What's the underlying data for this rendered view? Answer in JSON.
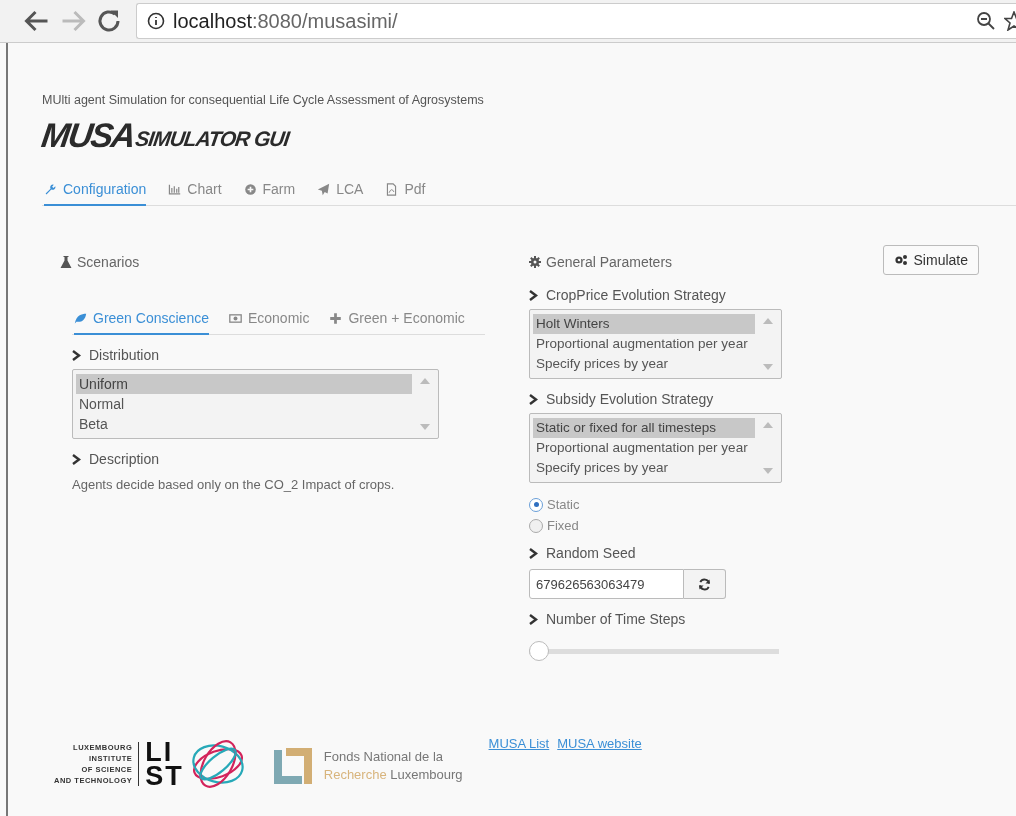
{
  "browser": {
    "host": "localhost",
    "path": ":8080/musasimi/"
  },
  "header": {
    "subtitle": "MUlti agent Simulation for consequential Life Cycle Assessment of Agrosystems",
    "logo_main": "MUSA",
    "logo_sub": "SIMULATOR GUI"
  },
  "tabs": [
    {
      "label": "Configuration",
      "selected": true
    },
    {
      "label": "Chart",
      "selected": false
    },
    {
      "label": "Farm",
      "selected": false
    },
    {
      "label": "LCA",
      "selected": false
    },
    {
      "label": "Pdf",
      "selected": false
    }
  ],
  "scenarios": {
    "title": "Scenarios",
    "tabs": [
      {
        "label": "Green Conscience",
        "selected": true
      },
      {
        "label": "Economic",
        "selected": false
      },
      {
        "label": "Green + Economic",
        "selected": false
      }
    ],
    "distribution": {
      "label": "Distribution",
      "options": [
        {
          "label": "Uniform",
          "selected": true
        },
        {
          "label": "Normal",
          "selected": false
        },
        {
          "label": "Beta",
          "selected": false
        }
      ]
    },
    "description": {
      "label": "Description",
      "text": "Agents decide based only on the CO_2 Impact of crops."
    }
  },
  "general": {
    "title": "General Parameters",
    "simulate": "Simulate",
    "crop_price": {
      "label": "CropPrice Evolution Strategy",
      "options": [
        {
          "label": "Holt Winters",
          "selected": true
        },
        {
          "label": "Proportional augmentation per year",
          "selected": false
        },
        {
          "label": "Specify prices by year",
          "selected": false
        }
      ]
    },
    "subsidy": {
      "label": "Subsidy Evolution Strategy",
      "options": [
        {
          "label": "Static or fixed for all timesteps",
          "selected": true
        },
        {
          "label": "Proportional augmentation per year",
          "selected": false
        },
        {
          "label": "Specify prices by year",
          "selected": false
        }
      ]
    },
    "radios": [
      {
        "label": "Static",
        "selected": true
      },
      {
        "label": "Fixed",
        "selected": false
      }
    ],
    "seed": {
      "label": "Random Seed",
      "value": "679626563063479"
    },
    "time_steps": {
      "label": "Number of Time Steps",
      "level": 0
    }
  },
  "footer": {
    "list_logo": {
      "lines": [
        "LUXEMBOURG",
        "INSTITUTE",
        "OF SCIENCE",
        "AND TECHNOLOGY"
      ],
      "mark_top": "LI",
      "mark_bottom": "ST"
    },
    "fnr_logo": {
      "line1": "Fonds National de la",
      "line2_accent": "Recherche",
      "line2_rest": "Luxembourg"
    },
    "links": [
      "MUSA List",
      "MUSA website"
    ]
  }
}
